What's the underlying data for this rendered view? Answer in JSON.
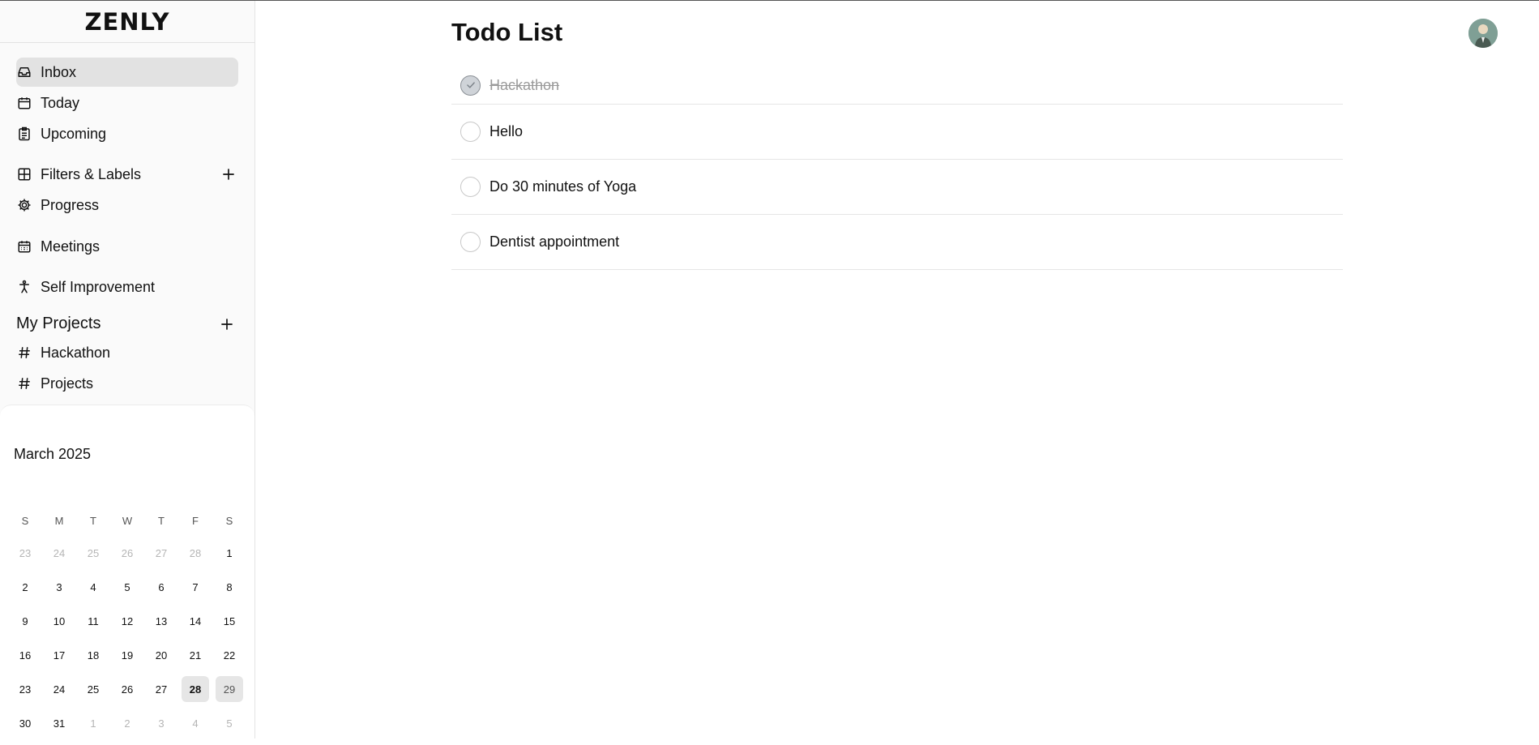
{
  "app": {
    "logo": "ZENLY"
  },
  "sidebar": {
    "items": [
      {
        "label": "Inbox",
        "icon": "inbox-icon",
        "active": true
      },
      {
        "label": "Today",
        "icon": "calendar-icon"
      },
      {
        "label": "Upcoming",
        "icon": "clipboard-icon"
      },
      {
        "label": "Filters & Labels",
        "icon": "grid-icon"
      },
      {
        "label": "Progress",
        "icon": "gear-icon"
      },
      {
        "label": "Meetings",
        "icon": "calendar-grid-icon"
      },
      {
        "label": "Self Improvement",
        "icon": "person-icon"
      }
    ],
    "projects_title": "My Projects",
    "projects": [
      {
        "label": "Hackathon",
        "icon": "hash-icon"
      },
      {
        "label": "Projects",
        "icon": "hash-icon"
      }
    ]
  },
  "calendar": {
    "title": "March 2025",
    "weekdays": [
      "S",
      "M",
      "T",
      "W",
      "T",
      "F",
      "S"
    ],
    "weeks": [
      [
        "23",
        "24",
        "25",
        "26",
        "27",
        "28",
        "1"
      ],
      [
        "2",
        "3",
        "4",
        "5",
        "6",
        "7",
        "8"
      ],
      [
        "9",
        "10",
        "11",
        "12",
        "13",
        "14",
        "15"
      ],
      [
        "16",
        "17",
        "18",
        "19",
        "20",
        "21",
        "22"
      ],
      [
        "23",
        "24",
        "25",
        "26",
        "27",
        "28",
        "29"
      ],
      [
        "30",
        "31",
        "1",
        "2",
        "3",
        "4",
        "5"
      ]
    ],
    "today": "28",
    "selected": "29"
  },
  "main": {
    "title": "Todo List",
    "todos": [
      {
        "text": "Hackathon",
        "done": true
      },
      {
        "text": "Hello",
        "done": false
      },
      {
        "text": "Do 30 minutes of Yoga",
        "done": false
      },
      {
        "text": "Dentist appointment",
        "done": false
      }
    ]
  }
}
